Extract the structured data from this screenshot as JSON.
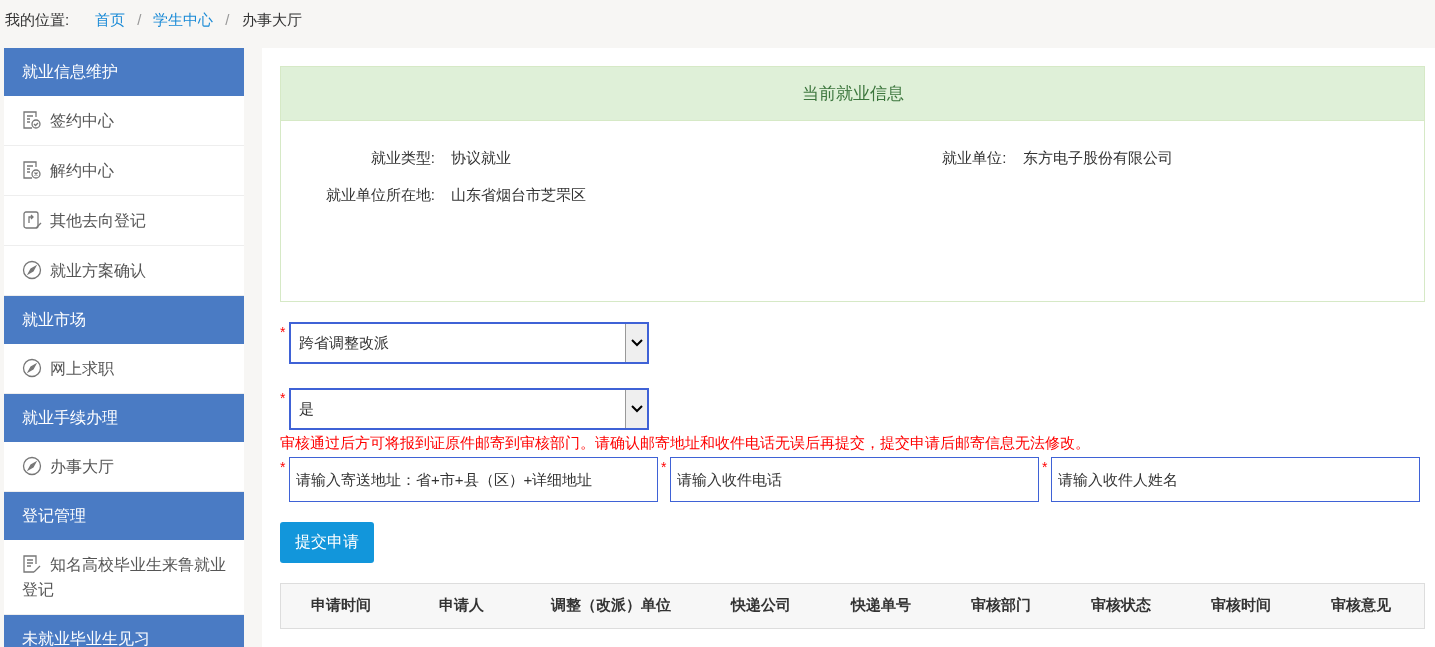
{
  "breadcrumb": {
    "label": "我的位置:",
    "links": [
      "首页",
      "学生中心"
    ],
    "separator": "/",
    "current": "办事大厅"
  },
  "sidebar": [
    {
      "kind": "header",
      "label": "就业信息维护"
    },
    {
      "kind": "sign",
      "label": "签约中心",
      "selected": false
    },
    {
      "kind": "cancel",
      "label": "解约中心",
      "selected": false
    },
    {
      "kind": "register",
      "label": "其他去向登记",
      "selected": false
    },
    {
      "kind": "compass",
      "label": "就业方案确认",
      "selected": false
    },
    {
      "kind": "header",
      "label": "就业市场"
    },
    {
      "kind": "compass",
      "label": "网上求职",
      "selected": false
    },
    {
      "kind": "header",
      "label": "就业手续办理"
    },
    {
      "kind": "compass",
      "label": "办事大厅",
      "selected": false
    },
    {
      "kind": "header",
      "label": "登记管理"
    },
    {
      "kind": "note",
      "label": "知名高校毕业生来鲁就业登记",
      "selected": false
    },
    {
      "kind": "header",
      "label": "未就业毕业生见习"
    }
  ],
  "info_panel": {
    "title": "当前就业信息",
    "fields": [
      {
        "label": "就业类型:",
        "value": "协议就业"
      },
      {
        "label": "就业单位:",
        "value": "东方电子股份有限公司"
      },
      {
        "label": "就业单位所在地:",
        "value": "山东省烟台市芝罘区"
      }
    ]
  },
  "form": {
    "required_mark": "*",
    "selects": [
      {
        "value": "跨省调整改派"
      },
      {
        "value": "是"
      }
    ],
    "notice": "审核通过后方可将报到证原件邮寄到审核部门。请确认邮寄地址和收件电话无误后再提交，提交申请后邮寄信息无法修改。",
    "inputs": [
      {
        "placeholder": "请输入寄送地址：省+市+县（区）+详细地址"
      },
      {
        "placeholder": "请输入收件电话"
      },
      {
        "placeholder": "请输入收件人姓名"
      }
    ],
    "submit": "提交申请"
  },
  "table": {
    "columns": [
      "申请时间",
      "申请人",
      "调整（改派）单位",
      "快递公司",
      "快递单号",
      "审核部门",
      "审核状态",
      "审核时间",
      "审核意见"
    ]
  }
}
